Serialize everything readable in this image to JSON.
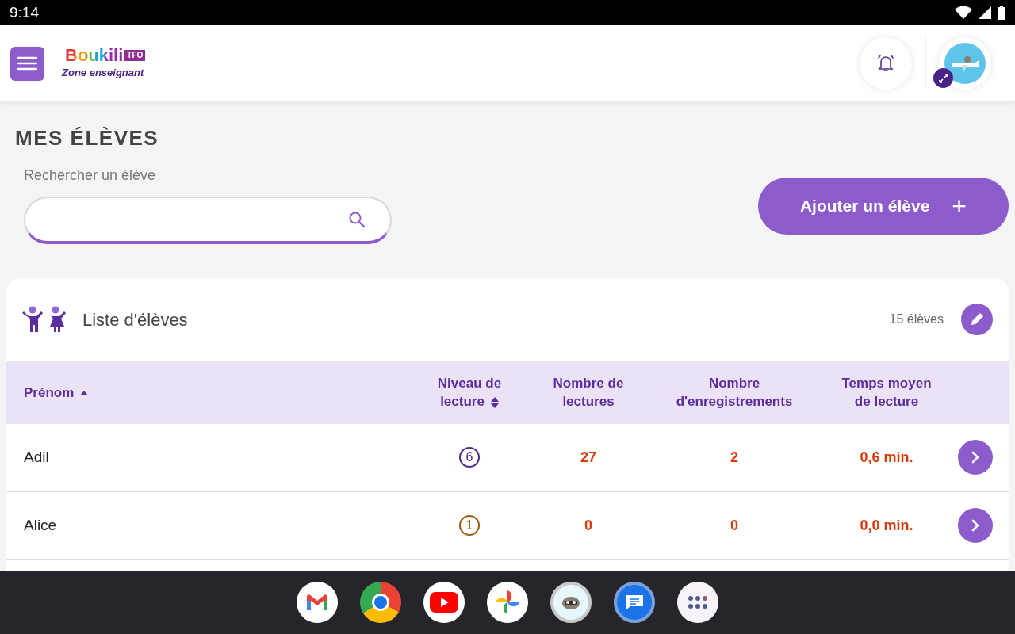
{
  "status_bar": {
    "time": "9:14"
  },
  "header": {
    "brand": "Boukili",
    "brand_badge": "TFO",
    "subtitle": "Zone enseignant"
  },
  "page_title": "MES ÉLÈVES",
  "search": {
    "label": "Rechercher un élève"
  },
  "add_button": {
    "label": "Ajouter un élève",
    "icon": "+"
  },
  "student_list": {
    "title": "Liste d'élèves",
    "count": "15 élèves",
    "columns": [
      {
        "label": "Prénom",
        "kind": "ascending"
      },
      {
        "label": "Niveau de lecture",
        "kind": "sortable"
      },
      {
        "label": "Nombre de lectures",
        "kind": "plain"
      },
      {
        "label": "Nombre d'enregistrements",
        "kind": "plain"
      },
      {
        "label": "Temps moyen de lecture",
        "kind": "plain"
      }
    ],
    "rows": [
      {
        "name": "Adil",
        "level": "6",
        "color": "#4a2a8c",
        "readings": "27",
        "recordings": "2",
        "avg_time": "0,6 min."
      },
      {
        "name": "Alice",
        "level": "1",
        "color": "#9a5a10",
        "readings": "0",
        "recordings": "0",
        "avg_time": "0,0 min."
      }
    ]
  },
  "dock": {
    "apps": [
      {
        "kind": "mail"
      },
      {
        "kind": "browser"
      },
      {
        "kind": "video"
      },
      {
        "kind": "photos"
      },
      {
        "kind": "raccoon"
      },
      {
        "kind": "messages"
      },
      {
        "kind": "apps"
      }
    ]
  }
}
